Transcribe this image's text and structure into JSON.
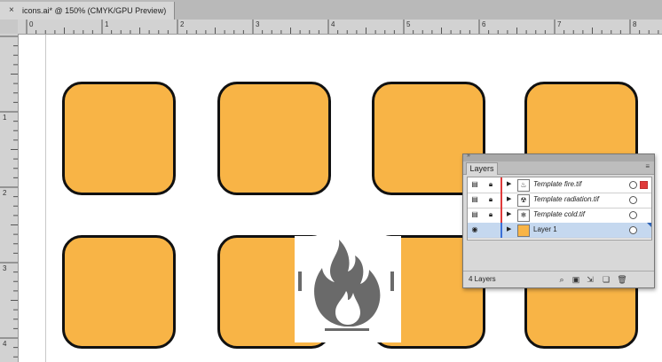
{
  "document_tab": {
    "close_glyph": "×",
    "title": "icons.ai* @ 150% (CMYK/GPU Preview)"
  },
  "ruler": {
    "horizontal_labels": [
      "0",
      "1",
      "2",
      "3",
      "4",
      "5",
      "6",
      "7",
      "8"
    ],
    "vertical_labels": [
      "1",
      "2",
      "3",
      "4"
    ]
  },
  "layers_panel": {
    "tab_label": "Layers",
    "menu_glyph": "≡",
    "layers": [
      {
        "name": "Template fire.tif",
        "visibility_icon": "template-icon",
        "locked": true,
        "color": "#e03a3a",
        "selected_art": true
      },
      {
        "name": "Template radiation.tif",
        "visibility_icon": "template-icon",
        "locked": true,
        "color": "#e03a3a",
        "selected_art": false
      },
      {
        "name": "Template cold.tif",
        "visibility_icon": "template-icon",
        "locked": true,
        "color": "#e03a3a",
        "selected_art": false
      },
      {
        "name": "Layer 1",
        "visibility_icon": "eye-icon",
        "locked": false,
        "color": "#3a6fd8",
        "selected_art": false
      }
    ],
    "layer_count": "4 Layers"
  },
  "colors": {
    "tile_fill": "#f8b446",
    "tile_stroke": "#111111",
    "flame_gray": "#6a6a6a"
  }
}
